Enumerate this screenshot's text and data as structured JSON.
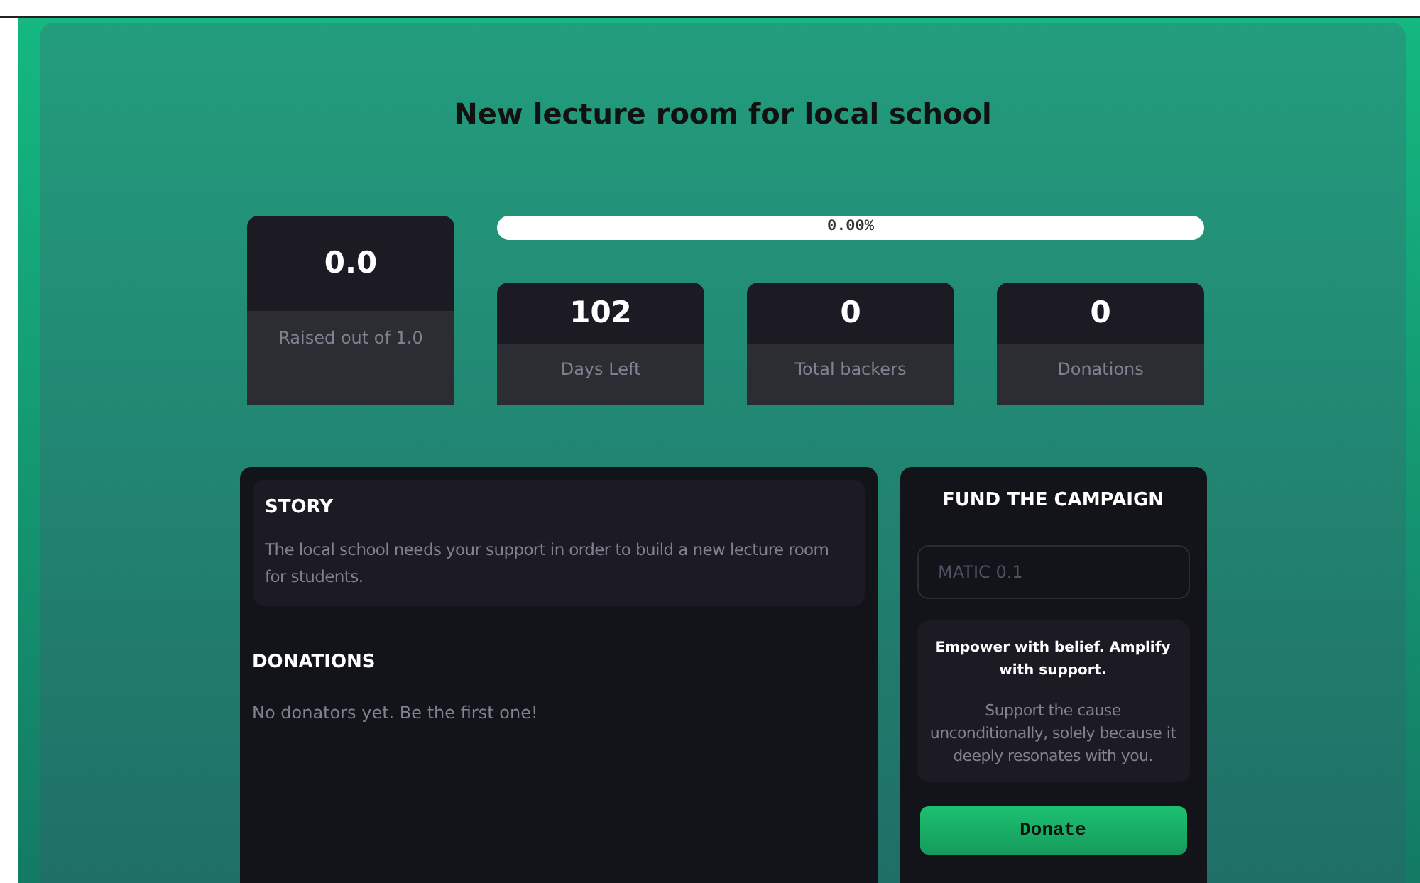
{
  "title": "New lecture room for local school",
  "raised": {
    "value": "0.0",
    "label": "Raised out of 1.0"
  },
  "progress": {
    "label": "0.00%",
    "level": 0
  },
  "stats": [
    {
      "value": "102",
      "label": "Days Left"
    },
    {
      "value": "0",
      "label": "Total backers"
    },
    {
      "value": "0",
      "label": "Donations"
    }
  ],
  "story": {
    "heading": "STORY",
    "text": "The local school needs your support in order to build a new lecture room for students."
  },
  "donations": {
    "heading": "DONATIONS",
    "empty_text": "No donators yet. Be the first one!"
  },
  "fund": {
    "heading": "FUND THE CAMPAIGN",
    "amount_field": {
      "placeholder": "MATIC 0.1"
    },
    "motto": "Empower with belief. Amplify with support.",
    "note": "Support the cause unconditionally, solely because it deeply resonates with you.",
    "button": "Donate"
  }
}
